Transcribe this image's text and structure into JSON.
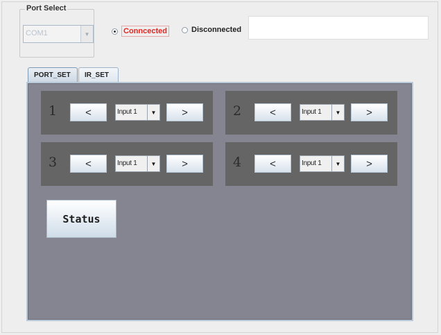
{
  "port_select": {
    "title": "Port Select",
    "selected_port": "COM1"
  },
  "connection": {
    "connected_label": "Conncected",
    "disconnected_label": "Disconnected",
    "selected": "connected",
    "status_text": ""
  },
  "tabs": [
    {
      "label": "PORT_SET",
      "active": true
    },
    {
      "label": "IR_SET",
      "active": false
    }
  ],
  "channels": [
    {
      "number": "1",
      "prev_label": "<",
      "input": "Input 1",
      "next_label": ">"
    },
    {
      "number": "2",
      "prev_label": "<",
      "input": "Input 1",
      "next_label": ">"
    },
    {
      "number": "3",
      "prev_label": "<",
      "input": "Input 1",
      "next_label": ">"
    },
    {
      "number": "4",
      "prev_label": "<",
      "input": "Input 1",
      "next_label": ">"
    }
  ],
  "status_button": {
    "label": "Status"
  },
  "icons": {
    "dropdown": "chevron-down-icon"
  },
  "colors": {
    "panel_bg": "#858591",
    "channel_bg": "#656565",
    "connected_text": "#e8241f"
  }
}
